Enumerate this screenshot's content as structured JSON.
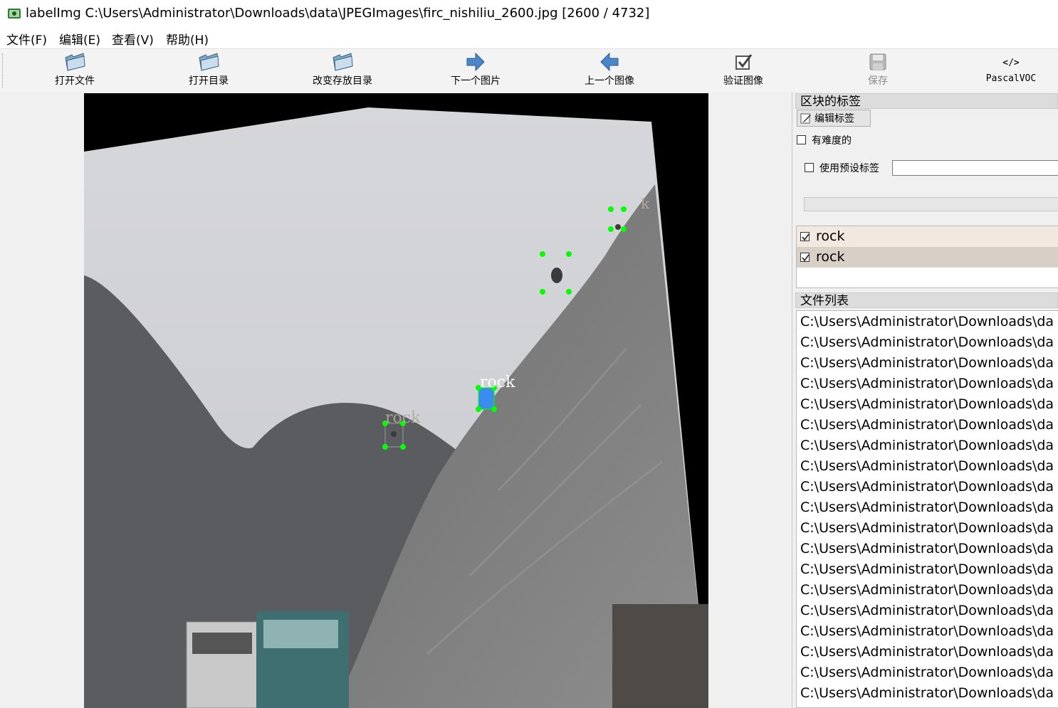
{
  "window": {
    "title": "labelImg C:\\Users\\Administrator\\Downloads\\data\\JPEGImages\\firc_nishiliu_2600.jpg [2600 / 4732]",
    "icon": "labelimg-app-icon"
  },
  "menu": [
    "文件(F)",
    "编辑(E)",
    "查看(V)",
    "帮助(H)"
  ],
  "toolbar": {
    "open_file": "打开文件",
    "open_dir": "打开目录",
    "change_save_dir": "改变存放目录",
    "next_image": "下一个图片",
    "prev_image": "上一个图像",
    "verify_image": "验证图像",
    "save": "保存",
    "format": "PascalVOC"
  },
  "canvas": {
    "boxes": [
      {
        "label": "rock",
        "selected": true,
        "label_visible": true
      },
      {
        "label": "rock",
        "selected": false,
        "label_visible": true
      },
      {
        "label": "",
        "selected": false,
        "label_visible": false
      },
      {
        "label": "k",
        "selected": false,
        "label_visible": true
      }
    ],
    "handle_color": "#00ff00",
    "selected_fill": "#3a8cf0"
  },
  "dock": {
    "box_labels_title": "区块的标签",
    "edit_label_button": "编辑标签",
    "difficult_label": "有难度的",
    "use_default_label": "使用预设标签",
    "default_label_value": "",
    "labels": [
      {
        "text": "rock",
        "checked": true,
        "bg": "#f3e8df"
      },
      {
        "text": "rock",
        "checked": true,
        "bg": "#d8cfc6"
      }
    ],
    "file_list_title": "文件列表",
    "files": [
      "C:\\Users\\Administrator\\Downloads\\da",
      "C:\\Users\\Administrator\\Downloads\\da",
      "C:\\Users\\Administrator\\Downloads\\da",
      "C:\\Users\\Administrator\\Downloads\\da",
      "C:\\Users\\Administrator\\Downloads\\da",
      "C:\\Users\\Administrator\\Downloads\\da",
      "C:\\Users\\Administrator\\Downloads\\da",
      "C:\\Users\\Administrator\\Downloads\\da",
      "C:\\Users\\Administrator\\Downloads\\da",
      "C:\\Users\\Administrator\\Downloads\\da",
      "C:\\Users\\Administrator\\Downloads\\da",
      "C:\\Users\\Administrator\\Downloads\\da",
      "C:\\Users\\Administrator\\Downloads\\da",
      "C:\\Users\\Administrator\\Downloads\\da",
      "C:\\Users\\Administrator\\Downloads\\da",
      "C:\\Users\\Administrator\\Downloads\\da",
      "C:\\Users\\Administrator\\Downloads\\da",
      "C:\\Users\\Administrator\\Downloads\\da",
      "C:\\Users\\Administrator\\Downloads\\da"
    ]
  }
}
